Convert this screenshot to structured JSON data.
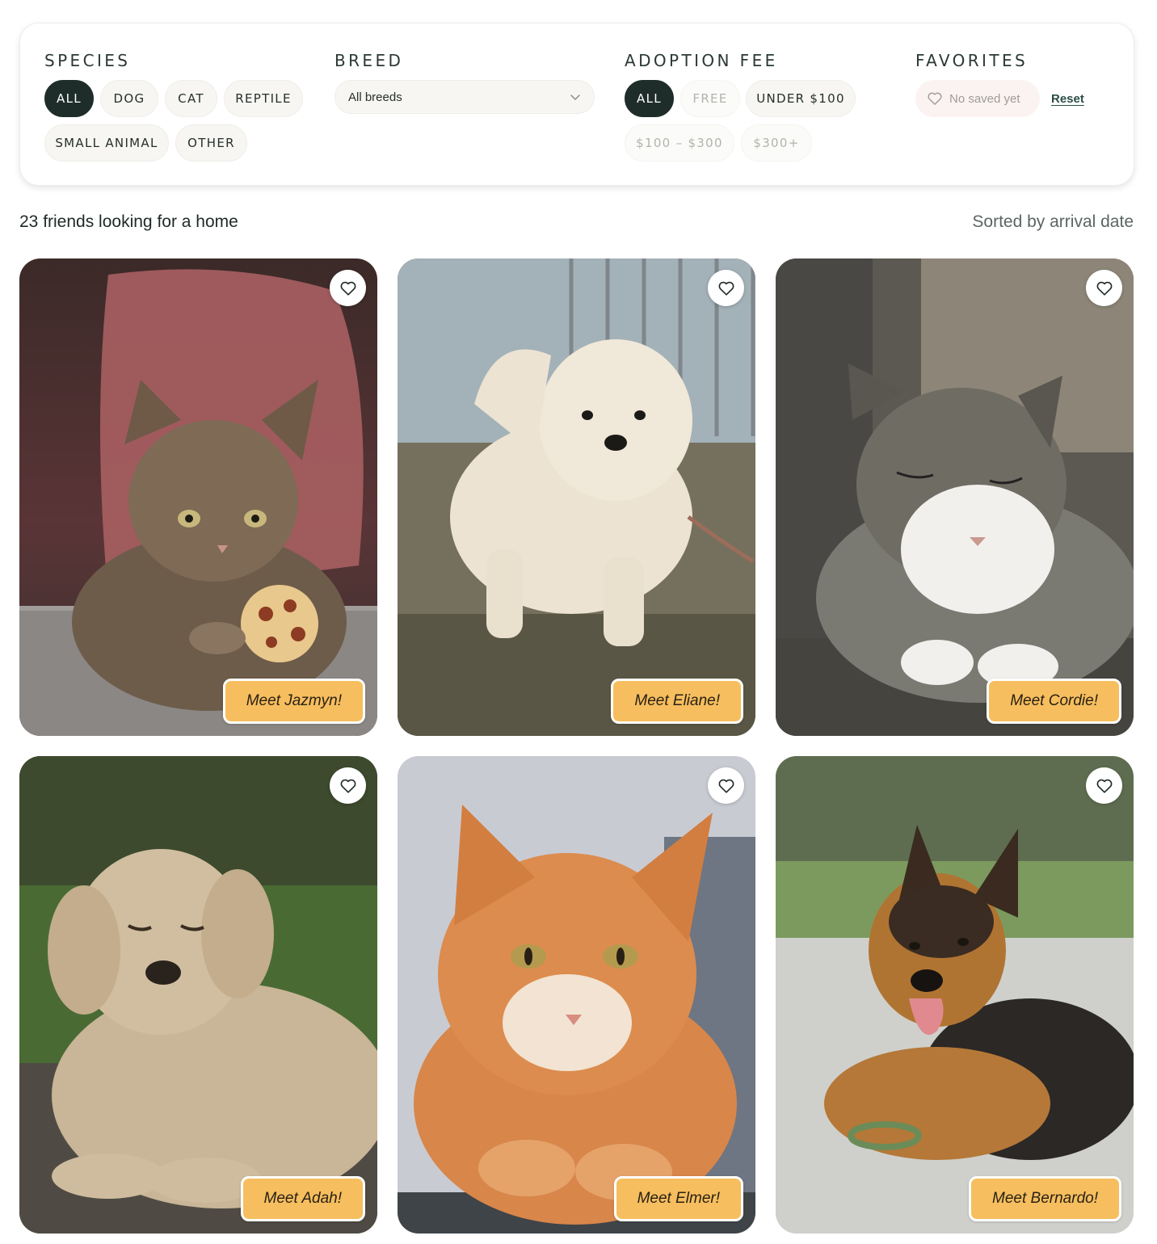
{
  "filters": {
    "species": {
      "title": "SPECIES",
      "options": [
        "ALL",
        "DOG",
        "CAT",
        "REPTILE",
        "SMALL ANIMAL",
        "OTHER"
      ],
      "selected": "ALL"
    },
    "breed": {
      "title": "BREED",
      "value": "All breeds"
    },
    "fee": {
      "title": "ADOPTION FEE",
      "options": [
        "ALL",
        "FREE",
        "UNDER $100",
        "$100 – $300",
        "$300+"
      ],
      "selected": "ALL"
    },
    "favorites": {
      "title": "FAVORITES",
      "empty_label": "No saved yet",
      "reset_label": "Reset"
    }
  },
  "results": {
    "count_text": "23 friends looking for a home",
    "sort_text": "Sorted by arrival date"
  },
  "pets": [
    {
      "name": "Jazmyn",
      "cta": "Meet Jazmyn!",
      "species": "cat"
    },
    {
      "name": "Eliane",
      "cta": "Meet Eliane!",
      "species": "dog"
    },
    {
      "name": "Cordie",
      "cta": "Meet Cordie!",
      "species": "cat"
    },
    {
      "name": "Adah",
      "cta": "Meet Adah!",
      "species": "dog"
    },
    {
      "name": "Elmer",
      "cta": "Meet Elmer!",
      "species": "cat"
    },
    {
      "name": "Bernardo",
      "cta": "Meet Bernardo!",
      "species": "dog"
    }
  ],
  "icons": {
    "favorite": "heart-outline-icon",
    "dropdown": "chevron-down-icon"
  },
  "colors": {
    "accent_dark": "#1e2d29",
    "cta_yellow": "#f6be5e",
    "chip_bg": "#f7f6f2"
  }
}
